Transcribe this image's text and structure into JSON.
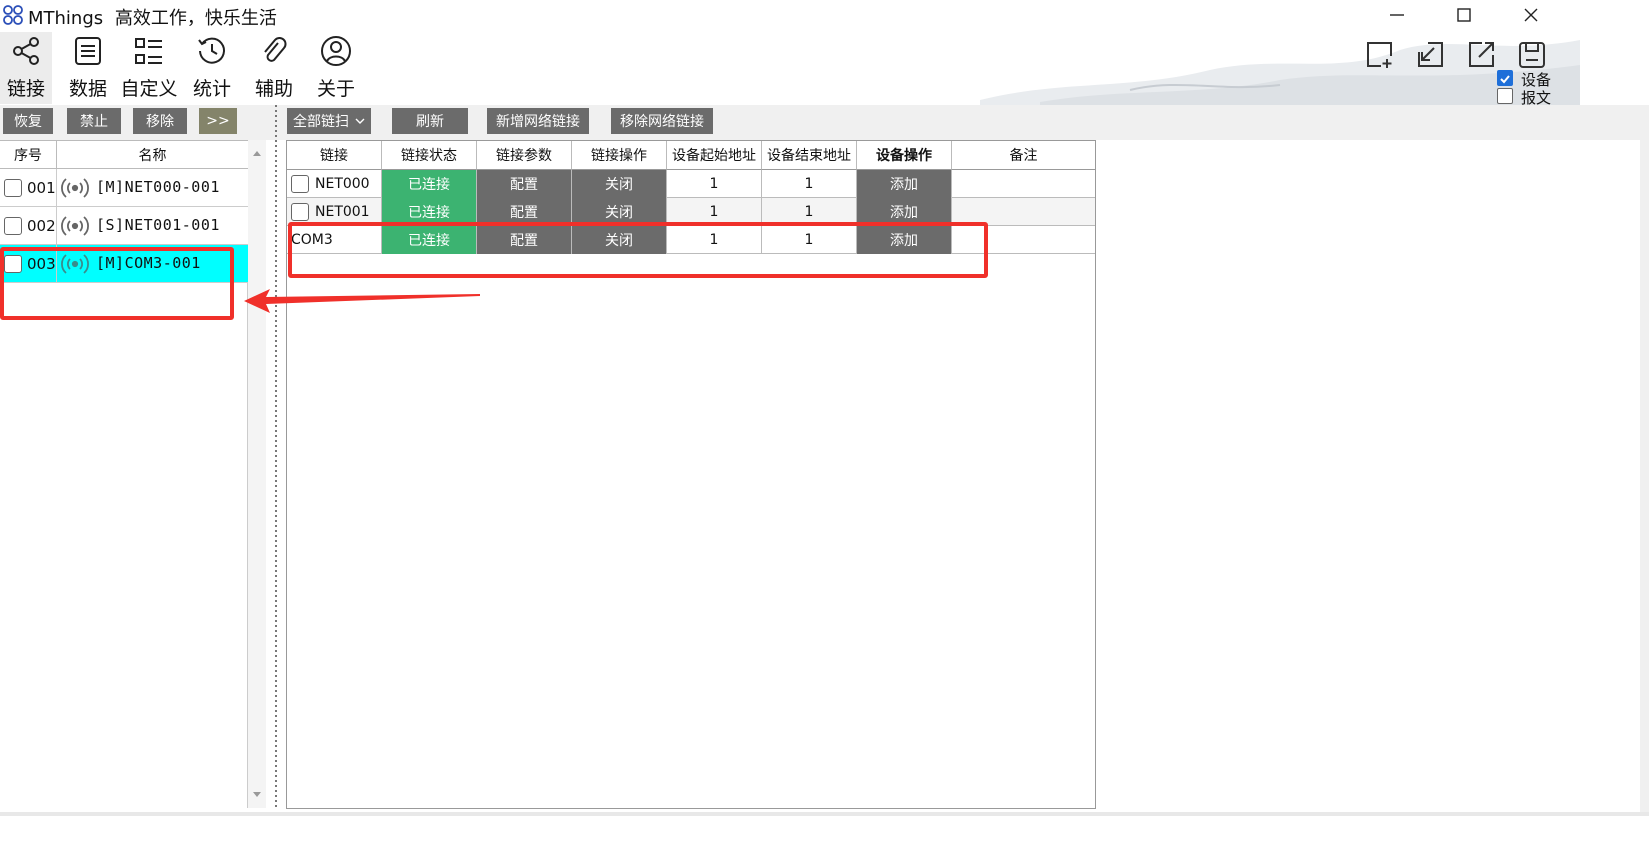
{
  "window": {
    "app_name": "MThings",
    "tagline": "高效工作，快乐生活"
  },
  "toolbar": {
    "items": [
      {
        "label": "链接",
        "icon": "share-icon",
        "active": true
      },
      {
        "label": "数据",
        "icon": "document-list-icon",
        "active": false
      },
      {
        "label": "自定义",
        "icon": "custom-list-icon",
        "active": false
      },
      {
        "label": "统计",
        "icon": "history-icon",
        "active": false
      },
      {
        "label": "辅助",
        "icon": "paperclip-icon",
        "active": false
      },
      {
        "label": "关于",
        "icon": "user-circle-icon",
        "active": false
      }
    ],
    "right_icons": [
      "add-window-icon",
      "import-icon",
      "export-icon",
      "save-icon"
    ],
    "check_device": {
      "label": "设备",
      "checked": true
    },
    "check_message": {
      "label": "报文",
      "checked": false
    }
  },
  "left_buttons": {
    "restore": "恢复",
    "disable": "禁止",
    "remove": "移除",
    "expand": ">>"
  },
  "right_buttons": {
    "filter": "全部链扫",
    "refresh": "刷新",
    "add_net": "新增网络链接",
    "remove_net": "移除网络链接"
  },
  "left_table": {
    "headers": [
      "序号",
      "名称"
    ],
    "rows": [
      {
        "num": "001",
        "name": "[M]NET000-001",
        "selected": false
      },
      {
        "num": "002",
        "name": "[S]NET001-001",
        "selected": false
      },
      {
        "num": "003",
        "name": "[M]COM3-001",
        "selected": true
      }
    ]
  },
  "right_table": {
    "headers": [
      "链接",
      "链接状态",
      "链接参数",
      "链接操作",
      "设备起始地址",
      "设备结束地址",
      "设备操作",
      "备注"
    ],
    "rows": [
      {
        "link": "NET000",
        "status": "已连接",
        "param": "配置",
        "op": "关闭",
        "start": "1",
        "end": "1",
        "dev_op": "添加",
        "note": ""
      },
      {
        "link": "NET001",
        "status": "已连接",
        "param": "配置",
        "op": "关闭",
        "start": "1",
        "end": "1",
        "dev_op": "添加",
        "note": ""
      },
      {
        "link": "COM3",
        "status": "已连接",
        "param": "配置",
        "op": "关闭",
        "start": "1",
        "end": "1",
        "dev_op": "添加",
        "note": ""
      }
    ]
  },
  "colors": {
    "connected": "#3cb371",
    "button_gray": "#6b6b6b",
    "selected_row": "#00ffff",
    "annotation": "#f0302a"
  }
}
